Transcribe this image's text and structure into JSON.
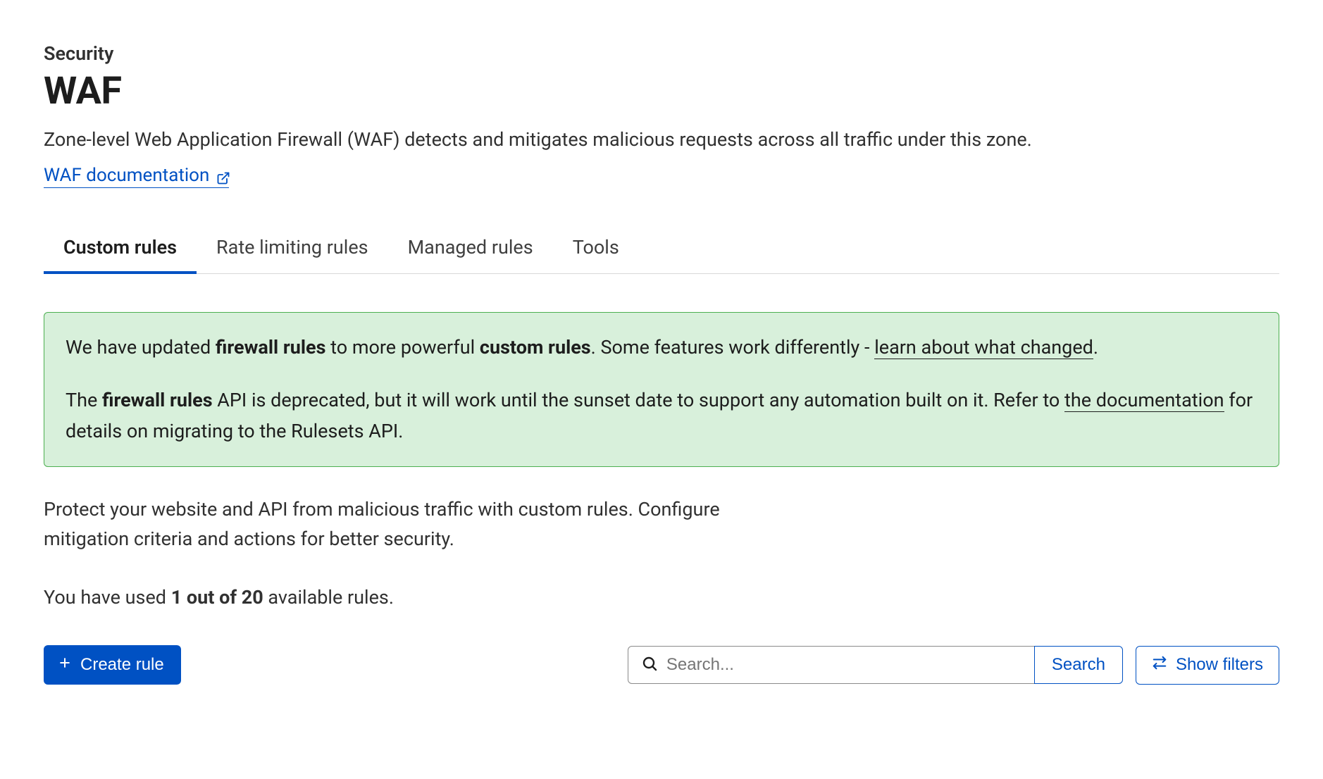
{
  "header": {
    "breadcrumb": "Security",
    "title": "WAF",
    "description": "Zone-level Web Application Firewall (WAF) detects and mitigates malicious requests across all traffic under this zone.",
    "doc_link_label": "WAF documentation"
  },
  "tabs": [
    {
      "label": "Custom rules",
      "active": true
    },
    {
      "label": "Rate limiting rules",
      "active": false
    },
    {
      "label": "Managed rules",
      "active": false
    },
    {
      "label": "Tools",
      "active": false
    }
  ],
  "notice": {
    "p1_part1": "We have updated ",
    "p1_bold1": "firewall rules",
    "p1_part2": " to more powerful ",
    "p1_bold2": "custom rules",
    "p1_part3": ". Some features work differently - ",
    "p1_link": "learn about what changed",
    "p1_part4": ".",
    "p2_part1": "The ",
    "p2_bold1": "firewall rules",
    "p2_part2": " API is deprecated, but it will work until the sunset date to support any automation built on it. Refer to ",
    "p2_link": "the documentation",
    "p2_part3": " for details on migrating to the Rulesets API."
  },
  "main": {
    "subtext": "Protect your website and API from malicious traffic with custom rules. Configure mitigation criteria and actions for better security.",
    "usage_prefix": "You have used ",
    "usage_bold": "1 out of 20",
    "usage_suffix": " available rules."
  },
  "actions": {
    "create_label": "Create rule",
    "search_placeholder": "Search...",
    "search_button": "Search",
    "show_filters": "Show filters"
  }
}
